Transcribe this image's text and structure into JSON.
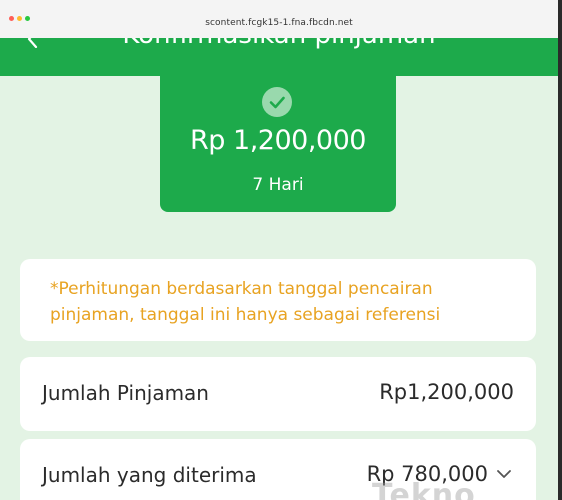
{
  "browser": {
    "url": "scontent.fcgk15-1.fna.fbcdn.net",
    "dot_colors": [
      "#ff5f57",
      "#febc2e",
      "#28c840"
    ]
  },
  "header": {
    "title": "Konfirmasikan pinjaman",
    "back_icon": "chevron-left-icon",
    "color": "#1daa4b"
  },
  "summary": {
    "amount": "Rp 1,200,000",
    "duration": "7 Hari",
    "status_icon": "check-circle-icon"
  },
  "notice": {
    "text": "*Perhitungan berdasarkan tanggal pencairan pinjaman, tanggal ini hanya sebagai referensi",
    "color": "#e8a322"
  },
  "details": [
    {
      "label": "Jumlah Pinjaman",
      "value": "Rp1,200,000"
    },
    {
      "label": "Jumlah yang diterima",
      "value": "Rp 780,000"
    }
  ],
  "watermark": "Tekno"
}
